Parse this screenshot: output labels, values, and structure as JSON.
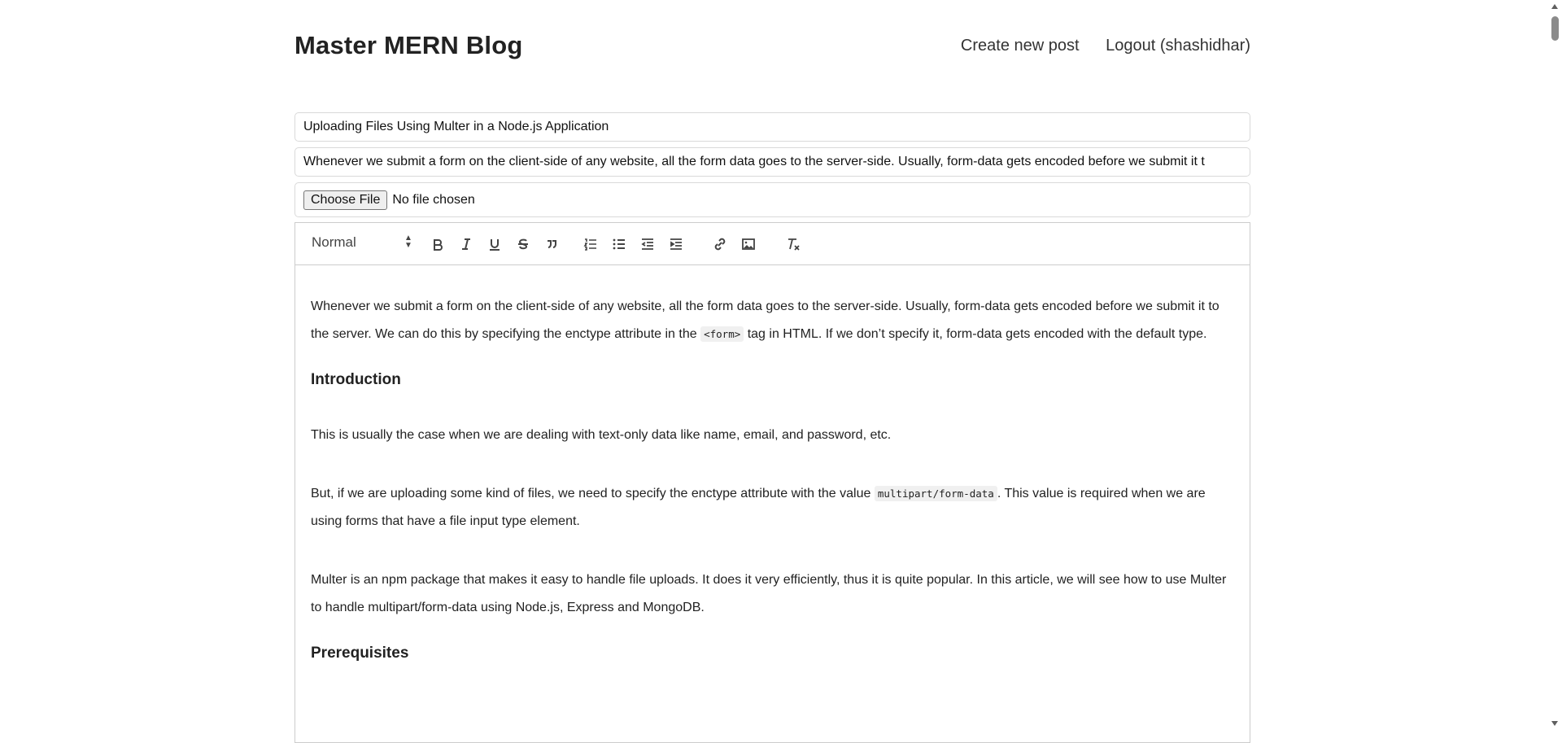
{
  "header": {
    "brand": "Master MERN Blog",
    "nav": [
      "Create new post",
      "Logout (shashidhar)"
    ]
  },
  "form": {
    "title_value": "Uploading Files Using Multer in a Node.js Application",
    "summary_value": "Whenever we submit a form on the client-side of any website, all the form data goes to the server-side. Usually, form-data gets encoded before we submit it t",
    "file_button": "Choose File",
    "file_status": "No file chosen"
  },
  "editor": {
    "header_select": "Normal",
    "toolbar_icons": [
      "bold-icon",
      "italic-icon",
      "underline-icon",
      "strike-icon",
      "blockquote-icon",
      "ordered-list-icon",
      "bullet-list-icon",
      "outdent-icon",
      "indent-icon",
      "link-icon",
      "image-icon",
      "clean-format-icon"
    ],
    "p1_a": "Whenever we submit a form on the client-side of any website, all the form data goes to the server-side. Usually, form-data gets encoded before we submit it to the server. We can do this by specifying the enctype attribute in the ",
    "p1_code": "<form>",
    "p1_b": " tag in HTML. If we don’t specify it, form-data gets encoded with the default type.",
    "h_intro": "Introduction",
    "p2": "This is usually the case when we are dealing with text-only data like name, email, and password, etc.",
    "p3_a": "But, if we are uploading some kind of files, we need to specify the enctype attribute with the value ",
    "p3_code": "multipart/form-data",
    "p3_b": ". This value is required when we are using forms that have a file input type element.",
    "p4": "Multer is an npm package that makes it easy to handle file uploads. It does it very efficiently, thus it is quite popular. In this article, we will see how to use Multer to handle multipart/form-data using Node.js, Express and MongoDB.",
    "h_prereq": "Prerequisites"
  }
}
